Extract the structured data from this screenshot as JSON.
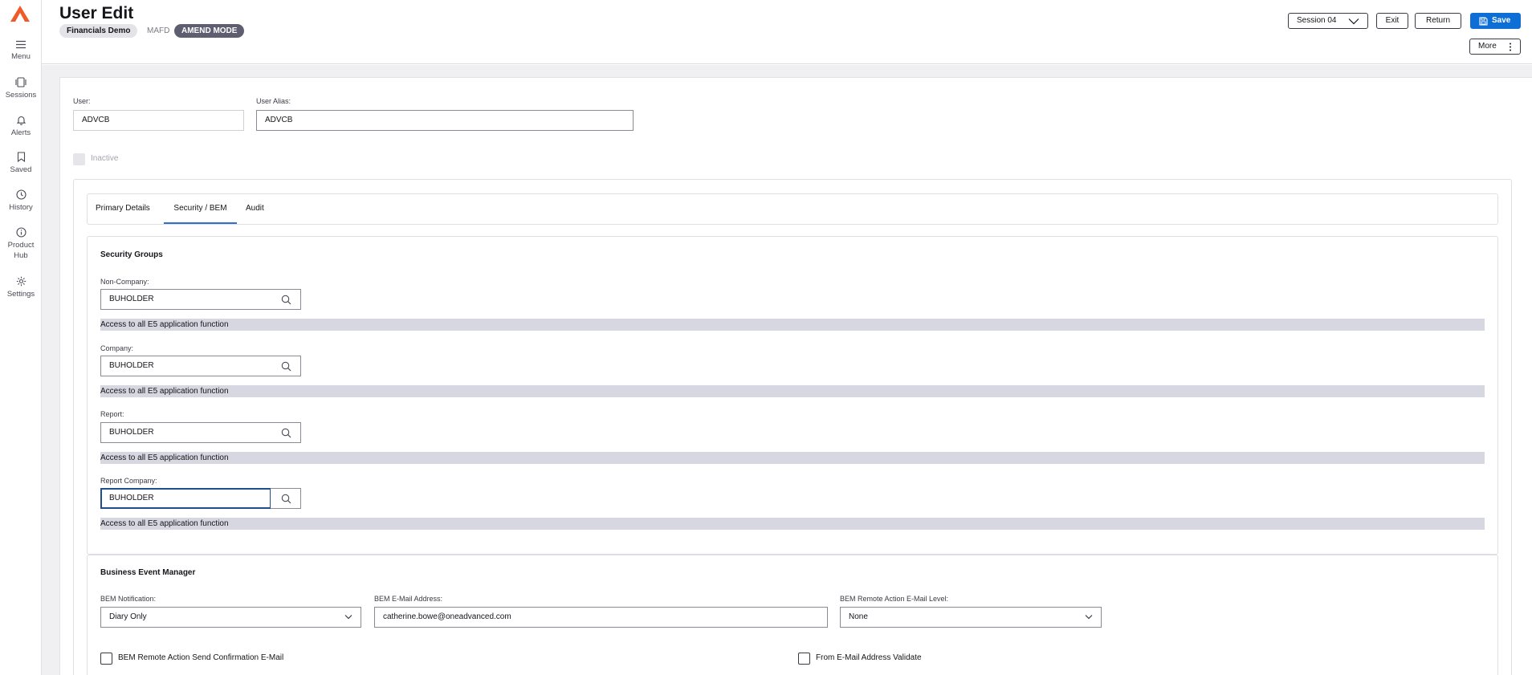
{
  "app": {
    "brand_color": "#f05a28",
    "accent_color": "#0d6fd6"
  },
  "rail": {
    "items": [
      {
        "label": "Menu",
        "icon": "hamburger-menu-icon"
      },
      {
        "label": "Sessions",
        "icon": "sessions-icon"
      },
      {
        "label": "Alerts",
        "icon": "bell-icon"
      },
      {
        "label": "Saved",
        "icon": "bookmark-icon"
      },
      {
        "label": "History",
        "icon": "clock-icon"
      },
      {
        "label": "Product",
        "label2": "Hub",
        "icon": "info-icon"
      },
      {
        "label": "Settings",
        "icon": "gear-icon"
      }
    ]
  },
  "header": {
    "title": "User Edit",
    "chips": [
      "Financials Demo",
      "MAFD",
      "AMEND MODE"
    ],
    "session_label": "Session 04",
    "exit_label": "Exit",
    "return_label": "Return",
    "save_label": "Save",
    "more_label": "More"
  },
  "user": {
    "user_label": "User:",
    "user_value": "ADVCB",
    "alias_label": "User Alias:",
    "alias_value": "ADVCB",
    "inactive_label": "Inactive"
  },
  "tabs": [
    {
      "label": "Primary Details",
      "active": false
    },
    {
      "label": "Security / BEM",
      "active": true
    },
    {
      "label": "Audit",
      "active": false
    }
  ],
  "security_groups": {
    "title": "Security Groups",
    "groups": [
      {
        "label": "Non-Company:",
        "value": "BUHOLDER",
        "description": "Access to all E5 application function"
      },
      {
        "label": "Company:",
        "value": "BUHOLDER",
        "description": "Access to all E5 application function"
      },
      {
        "label": "Report:",
        "value": "BUHOLDER",
        "description": "Access to all E5 application function"
      },
      {
        "label": "Report Company:",
        "value": "BUHOLDER",
        "description": "Access to all E5 application function"
      }
    ]
  },
  "bem": {
    "title": "Business Event Manager",
    "notification_label": "BEM Notification:",
    "notification_value": "Diary Only",
    "email_label": "BEM E-Mail Address:",
    "email_value": "catherine.bowe@oneadvanced.com",
    "remote_level_label": "BEM Remote Action E-Mail Level:",
    "remote_level_value": "None",
    "confirm_label": "BEM Remote Action Send Confirmation E-Mail",
    "validate_label": "From E-Mail Address Validate"
  }
}
